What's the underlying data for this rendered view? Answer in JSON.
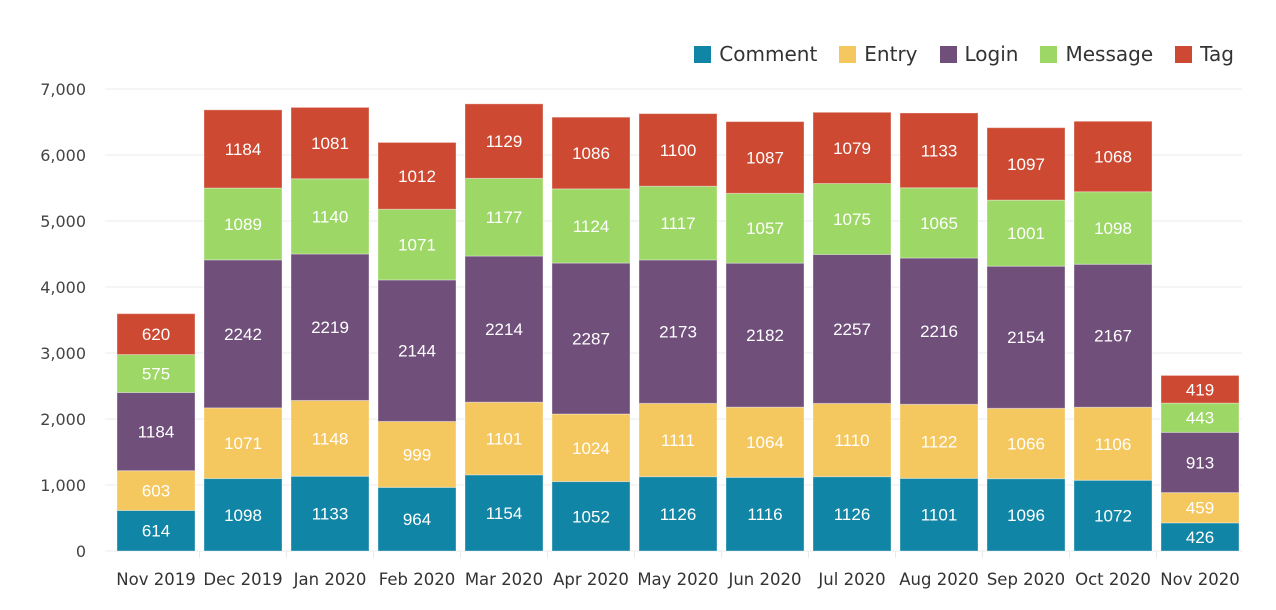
{
  "chart_data": {
    "type": "bar",
    "stacked": true,
    "title": "",
    "xlabel": "",
    "ylabel": "",
    "ylim": [
      0,
      7000
    ],
    "yticks": [
      0,
      1000,
      2000,
      3000,
      4000,
      5000,
      6000,
      7000
    ],
    "ytick_labels": [
      "0",
      "1,000",
      "2,000",
      "3,000",
      "4,000",
      "5,000",
      "6,000",
      "7,000"
    ],
    "grid": true,
    "legend_position": "top-right",
    "categories": [
      "Nov 2019",
      "Dec 2019",
      "Jan 2020",
      "Feb 2020",
      "Mar 2020",
      "Apr 2020",
      "May 2020",
      "Jun 2020",
      "Jul 2020",
      "Aug 2020",
      "Sep 2020",
      "Oct 2020",
      "Nov 2020"
    ],
    "series": [
      {
        "name": "Comment",
        "color": "#1185a6",
        "values": [
          614,
          1098,
          1133,
          964,
          1154,
          1052,
          1126,
          1116,
          1126,
          1101,
          1096,
          1072,
          426
        ]
      },
      {
        "name": "Entry",
        "color": "#f5c75f",
        "values": [
          603,
          1071,
          1148,
          999,
          1101,
          1024,
          1111,
          1064,
          1110,
          1122,
          1066,
          1106,
          459
        ]
      },
      {
        "name": "Login",
        "color": "#704f7b",
        "values": [
          1184,
          2242,
          2219,
          2144,
          2214,
          2287,
          2173,
          2182,
          2257,
          2216,
          2154,
          2167,
          913
        ]
      },
      {
        "name": "Message",
        "color": "#9dd766",
        "values": [
          575,
          1089,
          1140,
          1071,
          1177,
          1124,
          1117,
          1057,
          1075,
          1065,
          1001,
          1098,
          443
        ]
      },
      {
        "name": "Tag",
        "color": "#cd4932",
        "values": [
          620,
          1184,
          1081,
          1012,
          1129,
          1086,
          1100,
          1087,
          1079,
          1133,
          1097,
          1068,
          419
        ]
      }
    ],
    "data_labels": true,
    "label_color": "#ffffff"
  }
}
